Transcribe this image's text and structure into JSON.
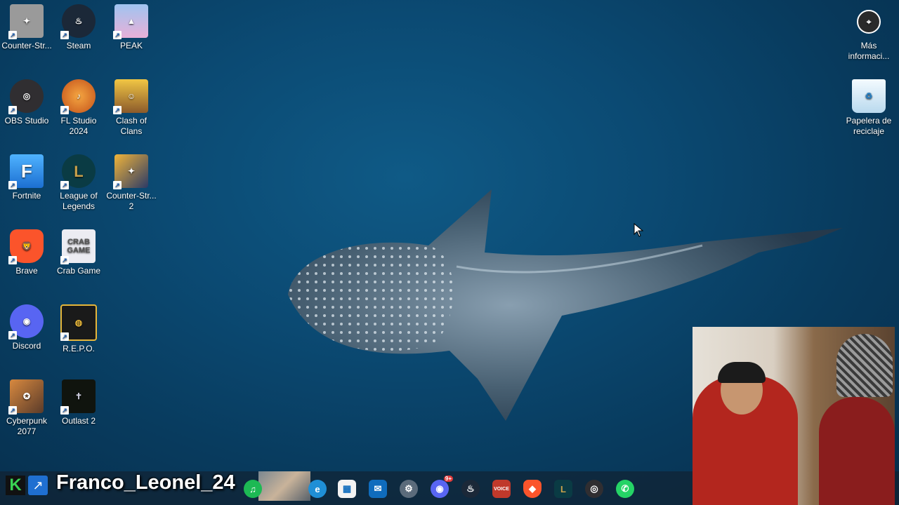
{
  "desktop": {
    "icons": [
      {
        "label": "Counter-Str...",
        "icon": "counter-strike-icon",
        "color": "#8a8a8a"
      },
      {
        "label": "Steam",
        "icon": "steam-icon",
        "color": "#1b2838"
      },
      {
        "label": "PEAK",
        "icon": "peak-icon",
        "color": "#7fa8e0"
      },
      {
        "label": "OBS Studio",
        "icon": "obs-icon",
        "color": "#302e31"
      },
      {
        "label": "FL Studio 2024",
        "icon": "fl-studio-icon",
        "color": "#f08a24"
      },
      {
        "label": "Clash of Clans",
        "icon": "clash-of-clans-icon",
        "color": "#e8b936"
      },
      {
        "label": "Fortnite",
        "icon": "fortnite-icon",
        "color": "#2f8ff0"
      },
      {
        "label": "League of Legends",
        "icon": "league-of-legends-icon",
        "color": "#0a3b44"
      },
      {
        "label": "Counter-Str... 2",
        "icon": "counter-strike-2-icon",
        "color": "#d99a2b"
      },
      {
        "label": "Brave",
        "icon": "brave-icon",
        "color": "#fb542b"
      },
      {
        "label": "Crab Game",
        "icon": "crab-game-icon",
        "color": "#e9e9ef"
      },
      {
        "label": "Discord",
        "icon": "discord-icon",
        "color": "#5865f2"
      },
      {
        "label": "R.E.P.O.",
        "icon": "repo-icon",
        "color": "#1a1a1a"
      },
      {
        "label": "Cyberpunk 2077",
        "icon": "cyberpunk-icon",
        "color": "#b86a3a"
      },
      {
        "label": "Outlast 2",
        "icon": "outlast-2-icon",
        "color": "#10140e"
      },
      {
        "label": "Más informaci...",
        "icon": "info-icon",
        "color": "#2a2a2a"
      },
      {
        "label": "Papelera de reciclaje",
        "icon": "recycle-bin-icon",
        "color": "#cfe6f5"
      }
    ]
  },
  "taskbar": {
    "overlay_name": "Franco_Leonel_24",
    "logo_k": "K",
    "logo_arrow": "↗",
    "apps": [
      {
        "icon": "spotify-icon",
        "color": "#1db954",
        "glyph": "♫"
      },
      {
        "icon": "edge-icon",
        "color": "#1f8fd6",
        "glyph": "e"
      },
      {
        "icon": "microsoft-store-icon",
        "color": "#f3f3f3",
        "glyph": "▦"
      },
      {
        "icon": "outlook-icon",
        "color": "#0f6cbd",
        "glyph": "✉"
      },
      {
        "icon": "settings-icon",
        "color": "#5b6b7b",
        "glyph": "⚙"
      },
      {
        "icon": "discord-icon",
        "color": "#5865f2",
        "glyph": "◉"
      },
      {
        "icon": "steam-icon",
        "color": "#1b2838",
        "glyph": "♨"
      },
      {
        "icon": "voicemeeter-icon",
        "color": "#c0392b",
        "glyph": "V"
      },
      {
        "icon": "brave-icon",
        "color": "#fb542b",
        "glyph": "◆"
      },
      {
        "icon": "league-of-legends-icon",
        "color": "#c8a04b",
        "glyph": "L"
      },
      {
        "icon": "obs-icon",
        "color": "#302e31",
        "glyph": "◎"
      },
      {
        "icon": "whatsapp-icon",
        "color": "#25d366",
        "glyph": "✆"
      }
    ],
    "discord_badge": "9+",
    "voice_label": "VOICE"
  }
}
